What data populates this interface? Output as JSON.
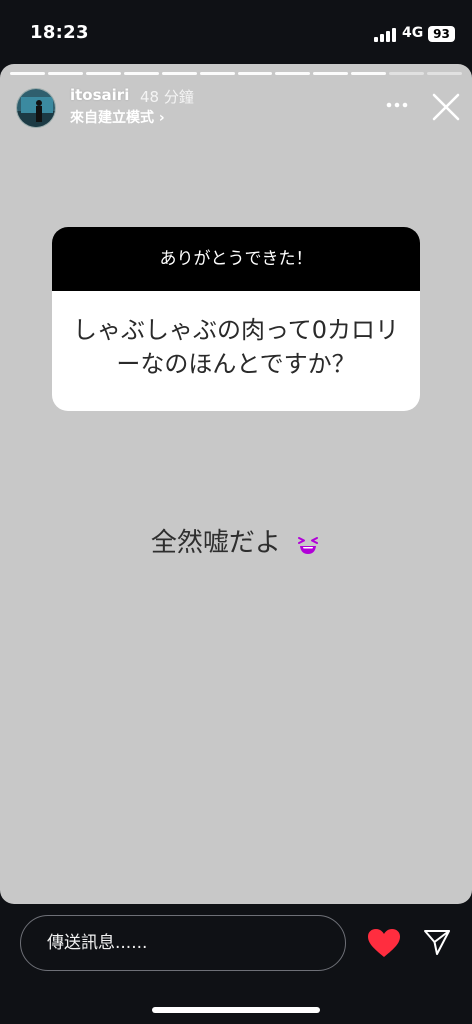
{
  "status_bar": {
    "time": "18:23",
    "network": "4G",
    "battery": "93"
  },
  "story": {
    "progress": {
      "segments_total": 12,
      "segments_done": 10
    },
    "username": "itosairi",
    "time_ago": "48 分鐘",
    "create_mode": "來自建立模式 ›",
    "background_color": "#c8c8c8",
    "question_sticker": {
      "title": "ありがとうできた！",
      "question": "しゃぶしゃぶの肉って0カロリーなのほんとですか？"
    },
    "answer_text": "全然嘘だよ",
    "answer_emoji": "grinning-squinting-face-icon"
  },
  "bottom_bar": {
    "message_placeholder": "傳送訊息......",
    "heart_color": "#ff2d3f"
  }
}
